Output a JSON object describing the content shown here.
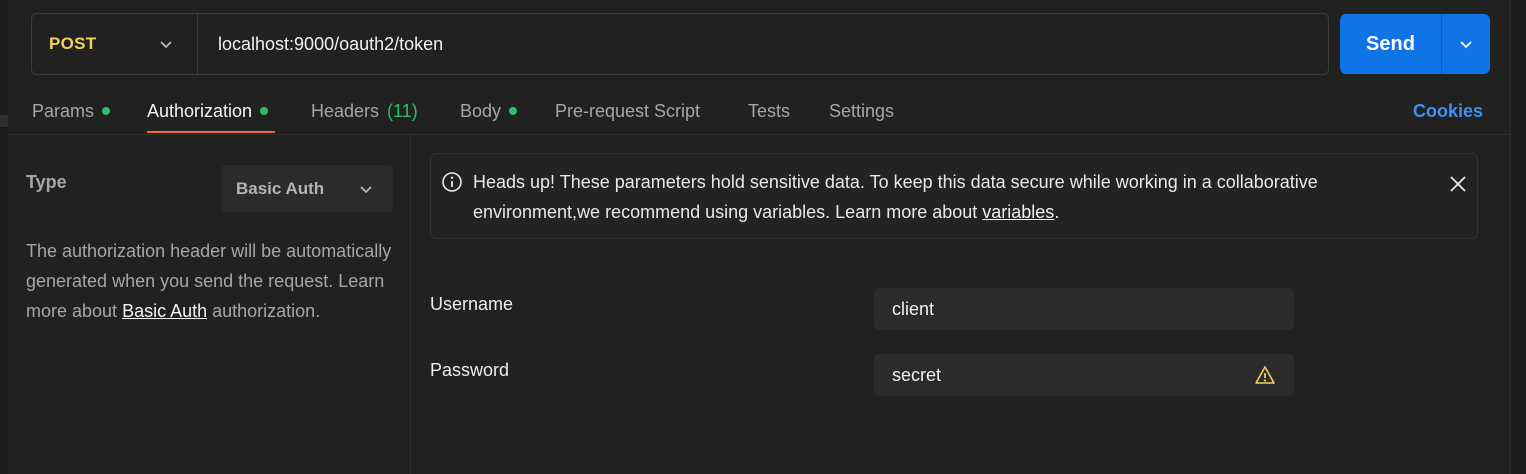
{
  "request": {
    "method": "POST",
    "url": "localhost:9000/oauth2/token",
    "send_label": "Send"
  },
  "tabs": {
    "params": "Params",
    "authorization": "Authorization",
    "headers": "Headers",
    "headers_count": "(11)",
    "body": "Body",
    "pre_request": "Pre-request Script",
    "tests": "Tests",
    "settings": "Settings",
    "cookies": "Cookies"
  },
  "auth": {
    "type_label": "Type",
    "type_value": "Basic Auth",
    "description_prefix": "The authorization header will be automatically generated when you send the request. Learn more about ",
    "description_link": "Basic Auth",
    "description_suffix": " authorization."
  },
  "banner": {
    "text": "Heads up! These parameters hold sensitive data. To keep this data secure while working in a collaborative environment,we recommend using variables. Learn more about ",
    "link": "variables",
    "suffix": "."
  },
  "fields": {
    "username_label": "Username",
    "username_value": "client",
    "password_label": "Password",
    "password_value": "secret"
  },
  "colors": {
    "method": "#f2d05c",
    "send": "#0f74e6",
    "active_indicator": "#f26b3a",
    "status_dot": "#2fbd6a",
    "link": "#3f90ef",
    "warning": "#f2d05c"
  },
  "icons": {
    "method_dropdown": "chevron-down-icon",
    "send_dropdown": "chevron-down-icon",
    "banner": "info-icon",
    "banner_close": "close-icon",
    "password_warning": "warning-icon"
  }
}
